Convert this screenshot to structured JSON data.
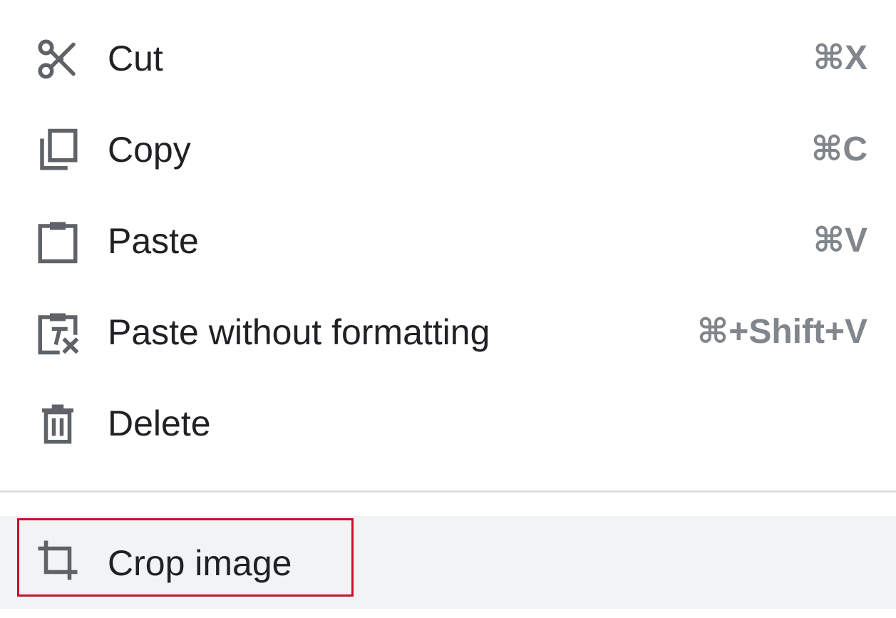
{
  "menu": {
    "items": [
      {
        "label": "Cut",
        "shortcut": "⌘X",
        "icon": "scissors-icon"
      },
      {
        "label": "Copy",
        "shortcut": "⌘C",
        "icon": "copy-icon"
      },
      {
        "label": "Paste",
        "shortcut": "⌘V",
        "icon": "clipboard-icon"
      },
      {
        "label": "Paste without formatting",
        "shortcut": "⌘+Shift+V",
        "icon": "clipboard-clear-format-icon"
      },
      {
        "label": "Delete",
        "shortcut": "",
        "icon": "trash-icon"
      }
    ],
    "crop": {
      "label": "Crop image",
      "icon": "crop-icon"
    }
  },
  "colors": {
    "text": "#202124",
    "shortcut": "#80868b",
    "icon": "#5f6368",
    "highlight_bg": "#f1f3f4",
    "highlight_border": "#c8102e",
    "divider": "#dadce0"
  }
}
